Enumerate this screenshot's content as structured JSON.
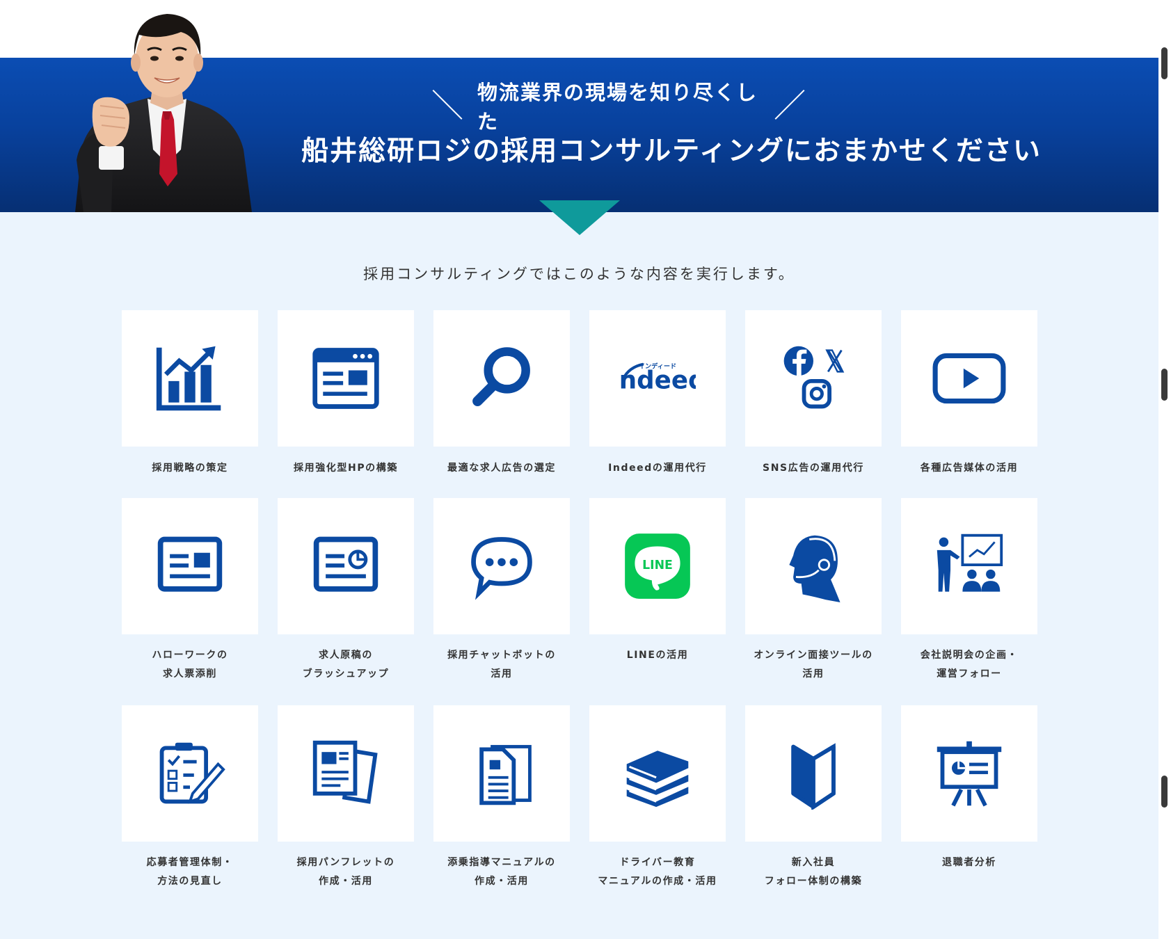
{
  "banner": {
    "tagline": "物流業界の現場を知り尽くした",
    "headline": "船井総研ロジの採用コンサルティングにおまかせください"
  },
  "intro": "採用コンサルティングではこのような内容を実行します。",
  "colors": {
    "brand_blue": "#0b4aa2",
    "teal": "#0f9a9b",
    "line_green": "#06c755",
    "background": "#ebf4fd"
  },
  "services": [
    {
      "icon": "bar-chart-icon",
      "lines": [
        "採用戦略の策定"
      ]
    },
    {
      "icon": "webpage-icon",
      "lines": [
        "採用強化型HPの構築"
      ]
    },
    {
      "icon": "magnifier-icon",
      "lines": [
        "最適な求人広告の選定"
      ]
    },
    {
      "icon": "indeed-logo-icon",
      "lines": [
        "Indeedの運用代行"
      ],
      "logo_text": "indeed",
      "logo_ruby": "インディード"
    },
    {
      "icon": "sns-icon",
      "lines": [
        "SNS広告の運用代行"
      ]
    },
    {
      "icon": "youtube-play-icon",
      "lines": [
        "各種広告媒体の活用"
      ]
    },
    {
      "icon": "news-card-icon",
      "lines": [
        "ハローワークの",
        "求人票添削"
      ]
    },
    {
      "icon": "document-chart-icon",
      "lines": [
        "求人原稿の",
        "ブラッシュアップ"
      ]
    },
    {
      "icon": "chat-bubble-icon",
      "lines": [
        "採用チャットボットの",
        "活用"
      ]
    },
    {
      "icon": "line-logo-icon",
      "lines": [
        "LINEの活用"
      ],
      "logo_text": "LINE"
    },
    {
      "icon": "headset-person-icon",
      "lines": [
        "オンライン面接ツールの",
        "活用"
      ]
    },
    {
      "icon": "presentation-icon",
      "lines": [
        "会社説明会の企画・",
        "運営フォロー"
      ]
    },
    {
      "icon": "clipboard-checklist-icon",
      "lines": [
        "応募者管理体制・",
        "方法の見直し"
      ]
    },
    {
      "icon": "pamphlet-icon",
      "lines": [
        "採用パンフレットの",
        "作成・活用"
      ]
    },
    {
      "icon": "manual-document-icon",
      "lines": [
        "添乗指導マニュアルの",
        "作成・活用"
      ]
    },
    {
      "icon": "book-stack-icon",
      "lines": [
        "ドライバー教育",
        "マニュアルの作成・活用"
      ]
    },
    {
      "icon": "beginner-mark-icon",
      "lines": [
        "新入社員",
        "フォロー体制の構築"
      ]
    },
    {
      "icon": "projector-screen-icon",
      "lines": [
        "退職者分析"
      ]
    }
  ]
}
